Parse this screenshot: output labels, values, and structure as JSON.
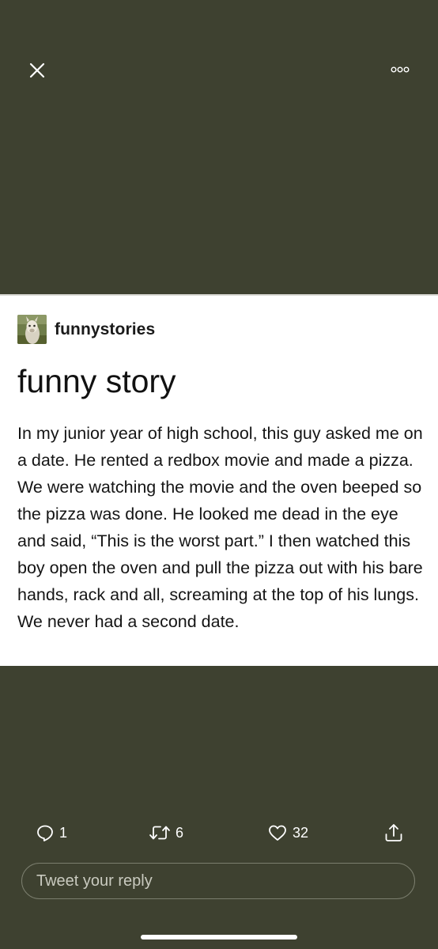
{
  "top_bar": {
    "close_icon": "close-icon",
    "more_icon": "more-options-icon"
  },
  "post": {
    "blog_name": "funnystories",
    "avatar_icon": "llama-avatar",
    "title": "funny story",
    "body": "In my junior year of high school, this guy asked me on a date. He rented a redbox movie and made a pizza. We were watching the movie and the oven beeped so the pizza was done. He looked me dead in the eye and said, “This is the worst part.” I then watched this boy open the oven and pull the pizza out with his bare hands, rack and all, screaming at the top of his lungs. We never had a second date."
  },
  "actions": {
    "reply_count": "1",
    "retweet_count": "6",
    "like_count": "32",
    "share_icon": "share-icon"
  },
  "reply": {
    "placeholder": "Tweet your reply"
  },
  "colors": {
    "background": "#3e4130",
    "card": "#ffffff",
    "text": "#151515"
  }
}
